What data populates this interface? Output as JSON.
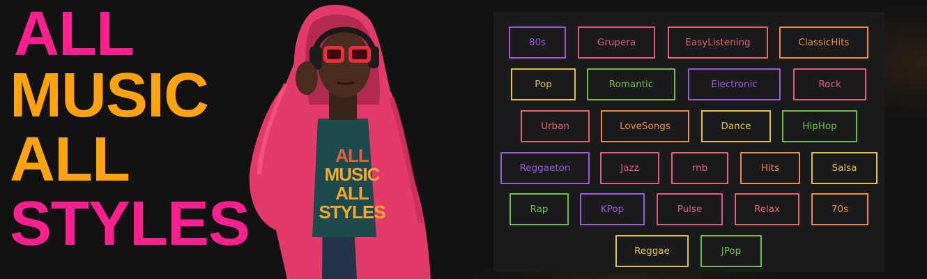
{
  "headline": {
    "line1": "ALL",
    "line2": "MUSIC",
    "line3": "ALL",
    "line4": "STYLES",
    "colors": {
      "pink": "#ff1f8f",
      "orange": "#ffa30a"
    }
  },
  "hero": {
    "shirt_lines": [
      "ALL",
      "MUSIC",
      "ALL",
      "STYLES"
    ]
  },
  "genres": {
    "rows": [
      [
        {
          "label": "80s",
          "color": "#9b59d6"
        },
        {
          "label": "Grupera",
          "color": "#e05a8a"
        },
        {
          "label": "EasyListening",
          "color": "#e8636d"
        },
        {
          "label": "ClassicHits",
          "color": "#f08a4b"
        }
      ],
      [
        {
          "label": "Pop",
          "color": "#e2c04a"
        },
        {
          "label": "Romantic",
          "color": "#6fbf4f"
        },
        {
          "label": "Electronic",
          "color": "#9b59d6"
        },
        {
          "label": "Rock",
          "color": "#e05a8a"
        }
      ],
      [
        {
          "label": "Urban",
          "color": "#e8636d"
        },
        {
          "label": "LoveSongs",
          "color": "#f08a4b"
        },
        {
          "label": "Dance",
          "color": "#e2c04a"
        },
        {
          "label": "HipHop",
          "color": "#6fbf4f"
        }
      ],
      [
        {
          "label": "Reggaeton",
          "color": "#9b59d6"
        },
        {
          "label": "Jazz",
          "color": "#e05a8a"
        },
        {
          "label": "rnb",
          "color": "#e8636d"
        },
        {
          "label": "Hits",
          "color": "#f08a4b"
        },
        {
          "label": "Salsa",
          "color": "#e2c04a"
        }
      ],
      [
        {
          "label": "Rap",
          "color": "#6fbf4f"
        },
        {
          "label": "KPop",
          "color": "#9b59d6"
        },
        {
          "label": "Pulse",
          "color": "#e05a8a"
        },
        {
          "label": "Relax",
          "color": "#e8636d"
        },
        {
          "label": "70s",
          "color": "#f08a4b"
        }
      ],
      [
        {
          "label": "Reggae",
          "color": "#e2c04a"
        },
        {
          "label": "JPop",
          "color": "#6fbf4f"
        }
      ]
    ]
  }
}
